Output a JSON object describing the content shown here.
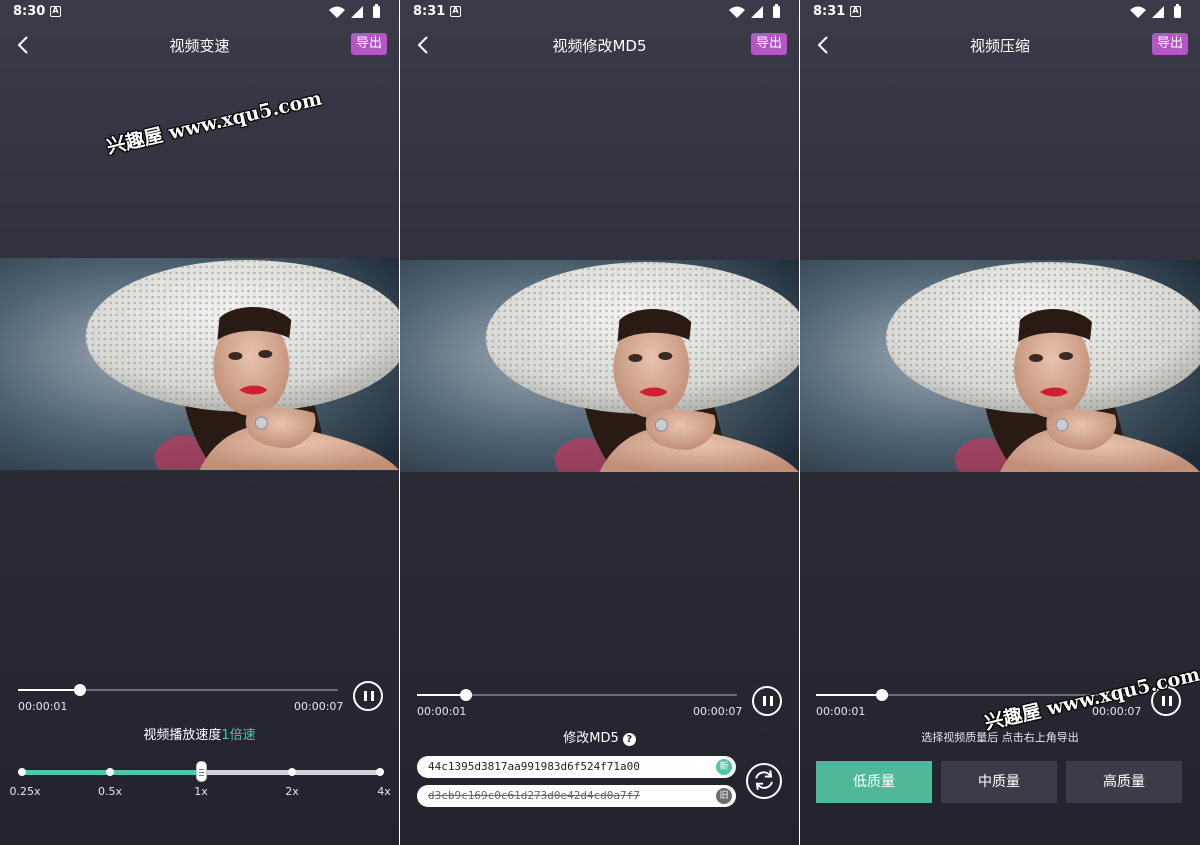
{
  "colors": {
    "accent": "#4fc7a4",
    "export": "#b556c4",
    "background": "#2b2b36",
    "quality_active": "#4fb89b"
  },
  "watermark": "兴趣屋 www.xqu5.com",
  "panels": [
    {
      "status_time": "8:30",
      "title": "视频变速",
      "export_label": "导出",
      "seek": {
        "progress": 0.2,
        "current": "00:00:01",
        "total": "00:00:07"
      },
      "speed": {
        "caption_prefix": "视频播放速度",
        "caption_value": "1倍速",
        "options": [
          "0.25x",
          "0.5x",
          "1x",
          "2x",
          "4x"
        ],
        "selected_index": 2
      }
    },
    {
      "status_time": "8:31",
      "title": "视频修改MD5",
      "export_label": "导出",
      "seek": {
        "progress": 0.16,
        "current": "00:00:01",
        "total": "00:00:07"
      },
      "md5": {
        "caption": "修改MD5",
        "help_icon": "?",
        "new_value": "44c1395d3817aa991983d6f524f71a00",
        "new_tag": "新",
        "old_value": "d3cb9c169c0c61d273d0e42d4cd0a7f7",
        "old_tag": "旧"
      }
    },
    {
      "status_time": "8:31",
      "title": "视频压缩",
      "export_label": "导出",
      "seek": {
        "progress": 0.2,
        "current": "00:00:01",
        "total": "00:00:07"
      },
      "compress": {
        "caption": "选择视频质量后 点击右上角导出",
        "options": [
          "低质量",
          "中质量",
          "高质量"
        ],
        "selected_index": 0
      }
    }
  ]
}
